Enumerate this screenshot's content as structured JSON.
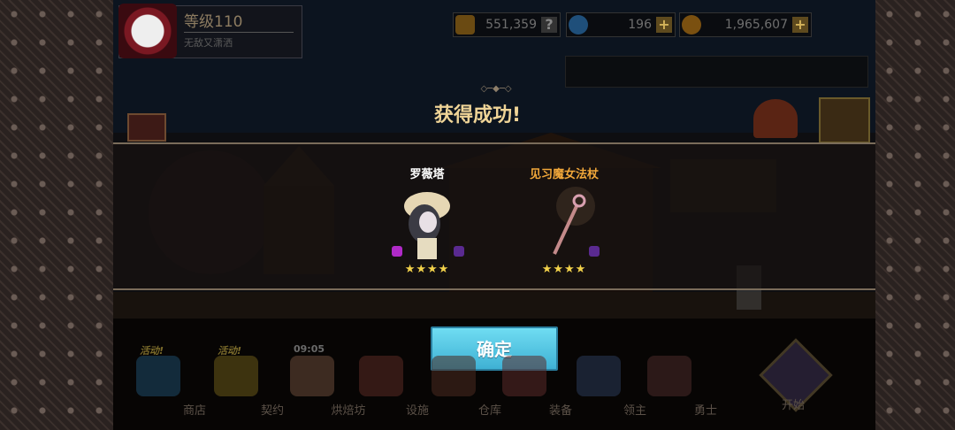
{
  "player": {
    "level": "等级110",
    "name": "无敌又潇洒"
  },
  "resources": [
    {
      "icon": "star-badge-icon",
      "value": "551,359",
      "color": "#8a6a1a"
    },
    {
      "icon": "diamond-icon",
      "value": "196",
      "color": "#2a6aa0"
    },
    {
      "icon": "coin-icon",
      "value": "1,965,607",
      "color": "#9a6a10"
    }
  ],
  "event_label": "活动",
  "popup": {
    "title": "获得成功!",
    "items": [
      {
        "name": "罗薇塔",
        "name_color": "#ffffff",
        "stars": "★★★★",
        "icon": "character-sprite-icon"
      },
      {
        "name": "见习魔女法杖",
        "name_color": "#f2a83a",
        "stars": "★★★★",
        "icon": "staff-icon"
      }
    ],
    "confirm_label": "确定"
  },
  "nav": [
    {
      "label": "商店",
      "hot": "活动!",
      "icon": "shop-gem-icon"
    },
    {
      "label": "契约",
      "hot": "活动!",
      "icon": "contract-icon"
    },
    {
      "label": "烘焙坊",
      "hot": "09:05",
      "icon": "bakery-icon"
    },
    {
      "label": "设施",
      "hot": "",
      "icon": "facility-icon"
    },
    {
      "label": "仓库",
      "hot": "",
      "icon": "storage-icon"
    },
    {
      "label": "装备",
      "hot": "",
      "icon": "equipment-icon"
    },
    {
      "label": "领主",
      "hot": "",
      "icon": "lord-icon"
    },
    {
      "label": "勇士",
      "hot": "",
      "icon": "warrior-icon"
    }
  ],
  "start_label": "开始"
}
